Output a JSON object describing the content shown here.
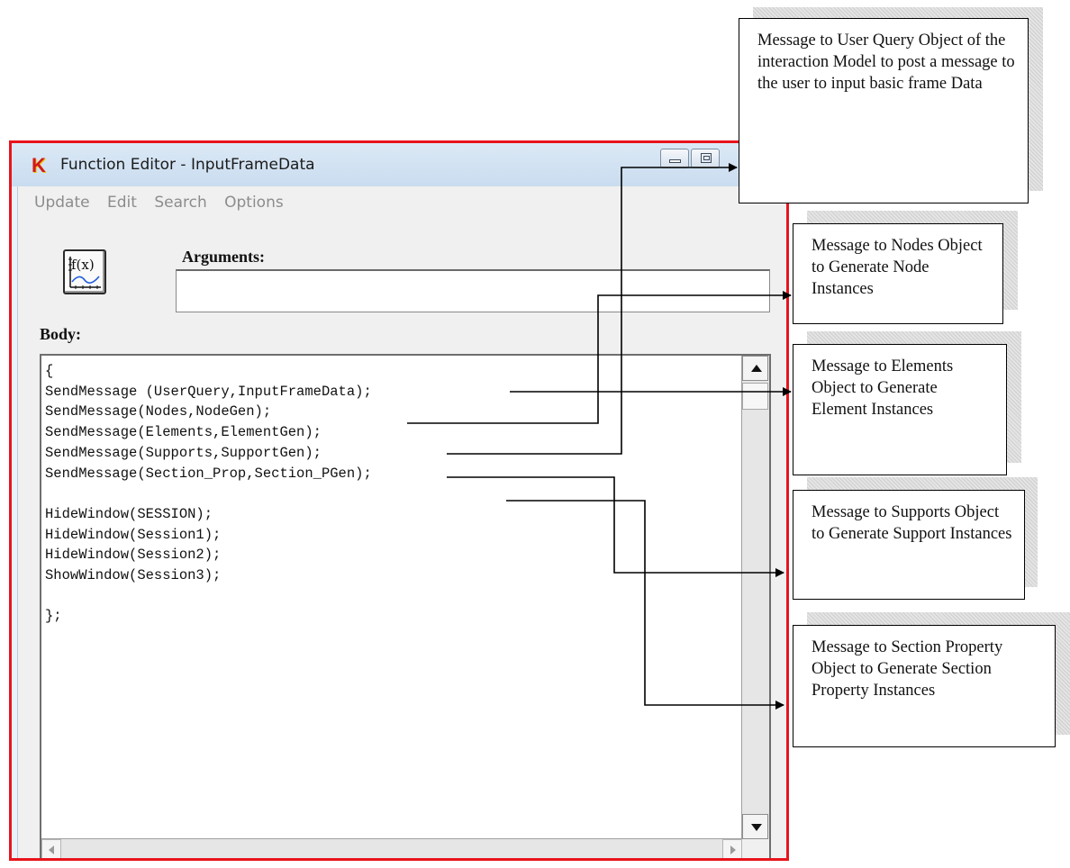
{
  "window": {
    "app_icon_glyph": "K",
    "title": "Function Editor - InputFrameData",
    "border_color": "#e8141c"
  },
  "menu": [
    "Update",
    "Edit",
    "Search",
    "Options"
  ],
  "arguments": {
    "label": "Arguments:",
    "value": ""
  },
  "function_button": {
    "label": "f(x)",
    "icon": "function-graph-icon"
  },
  "body_label": "Body:",
  "code_lines": [
    "{",
    "SendMessage (UserQuery,InputFrameData);",
    "SendMessage(Nodes,NodeGen);",
    "SendMessage(Elements,ElementGen);",
    "SendMessage(Supports,SupportGen);",
    "SendMessage(Section_Prop,Section_PGen);",
    "",
    "HideWindow(SESSION);",
    "HideWindow(Session1);",
    "HideWindow(Session2);",
    "ShowWindow(Session3);",
    "",
    "};"
  ],
  "callouts": {
    "user_query": "Message to User Query Object of the interaction Model to post a message to the user to input basic frame Data",
    "nodes": "Message to Nodes Object to Generate Node Instances",
    "elements": "Message to Elements Object to Generate Element Instances",
    "supports": "Message to Supports Object to Generate Support Instances",
    "section_property": "Message to Section Property Object to Generate Section Property Instances"
  }
}
